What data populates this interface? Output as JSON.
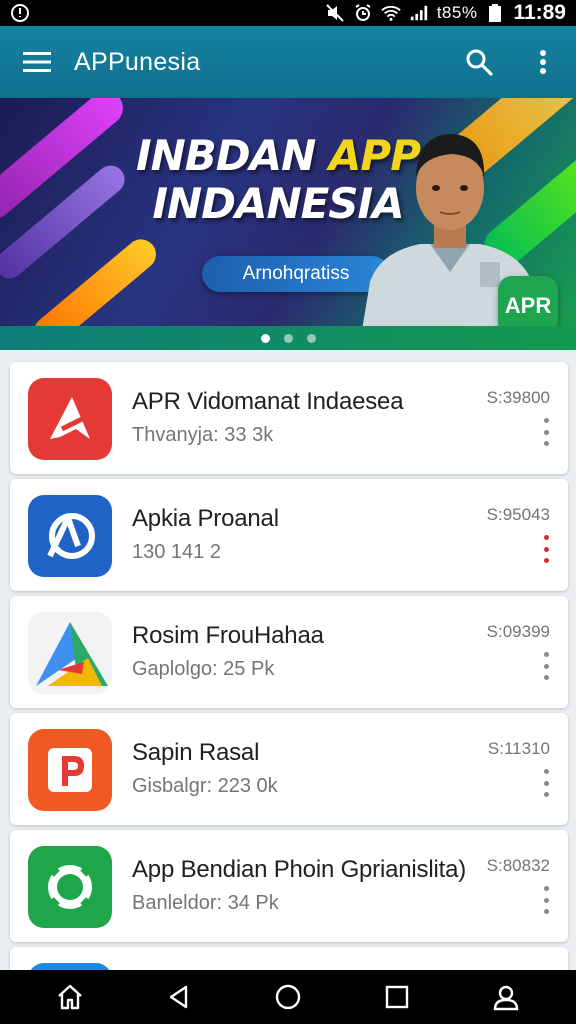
{
  "status_bar": {
    "battery_text": "t85%",
    "time": "11:89"
  },
  "app_bar": {
    "title": "APPunesia"
  },
  "banner": {
    "headline_line1_a": "INBDAN ",
    "headline_line1_b": "APP",
    "headline_line2": "INDANESIA",
    "cta_label": "Arnohqratiss",
    "badge_text": "APR",
    "carousel_total": 3,
    "carousel_active": 1
  },
  "apps": [
    {
      "name": "APR Vidomanat Indaesea",
      "meta": "Thvanyja: 33 3k",
      "size": "S:39800",
      "icon": "red-arrow-icon",
      "color": "#e53935"
    },
    {
      "name": "Apkia Proanal",
      "meta": "130 141 2",
      "size": "S:95043",
      "icon": "blue-circle-logo-icon",
      "color": "#1e63c5"
    },
    {
      "name": "Rosim FrouHahaa",
      "meta": "Gaplolgo: 25 Pk",
      "size": "S:09399",
      "icon": "triangle-logo-icon",
      "color": "#2ba86a"
    },
    {
      "name": "Sapin Rasal",
      "meta": "Gisbalgr: 223 0k",
      "size": "S:11310",
      "icon": "p-logo-icon",
      "color": "#f05a22"
    },
    {
      "name": "App Bendian Phoin Gprianislita)",
      "meta": "Banleldor: 34 Pk",
      "size": "S:80832",
      "icon": "ring-logo-icon",
      "color": "#1fa64a"
    }
  ],
  "colors": {
    "app_bar": "#1683a3",
    "status_bar": "#000000",
    "alert_menu": "#d32f2f"
  }
}
